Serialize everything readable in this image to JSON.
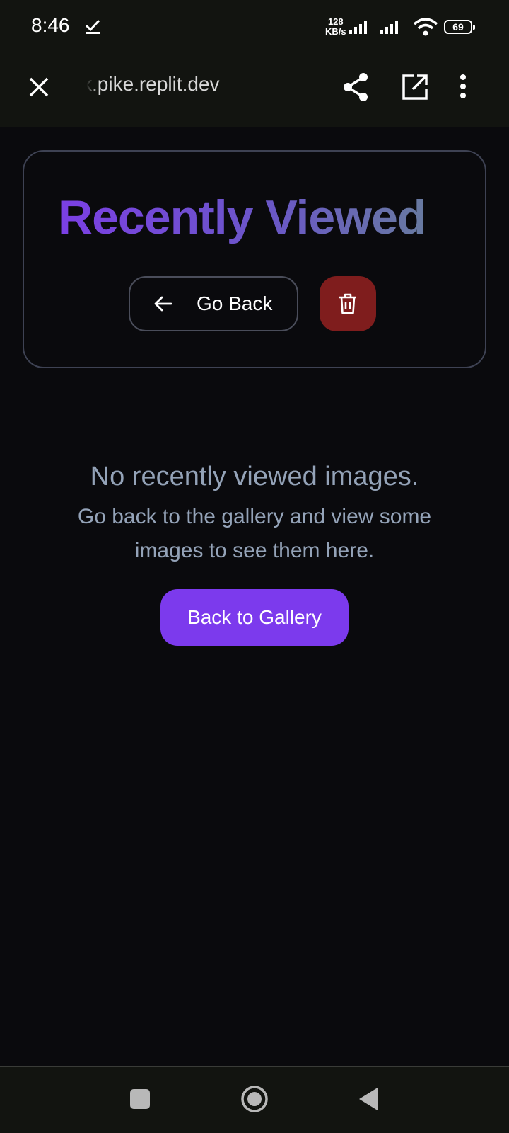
{
  "status_bar": {
    "time": "8:46",
    "speed_value": "128",
    "speed_unit": "KB/s",
    "battery": "69"
  },
  "browser": {
    "url": "k.pike.replit.dev"
  },
  "header": {
    "title": "Recently Viewed",
    "go_back_label": "Go Back"
  },
  "empty_state": {
    "title": "No recently viewed images.",
    "description": "Go back to the gallery and view some images to see them here.",
    "button_label": "Back to Gallery"
  },
  "colors": {
    "background": "#0a0a0d",
    "accent": "#7c3aed",
    "danger": "#7f1d1d",
    "muted_text": "#94a3b8"
  },
  "icons": [
    "check-icon",
    "signal-icon",
    "wifi-icon",
    "close-icon",
    "share-icon",
    "open-external-icon",
    "more-vert-icon",
    "arrow-left-icon",
    "trash-icon",
    "recents-icon",
    "home-icon",
    "back-icon"
  ]
}
